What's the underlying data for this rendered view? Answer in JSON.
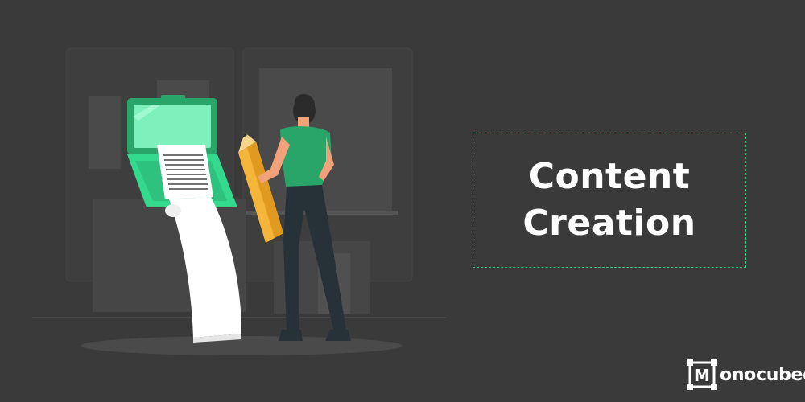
{
  "title": {
    "line1": "Content",
    "line2": "Creation"
  },
  "brand": {
    "mark_letter": "M",
    "name_rest": "onocubed"
  },
  "colors": {
    "background": "#3a3a3a",
    "accent": "#2ec27e",
    "laptop_green": "#33d98c",
    "shirt_green": "#2aa56a",
    "pencil": "#f5b53a"
  },
  "icons": [
    "logo-mark-icon"
  ]
}
